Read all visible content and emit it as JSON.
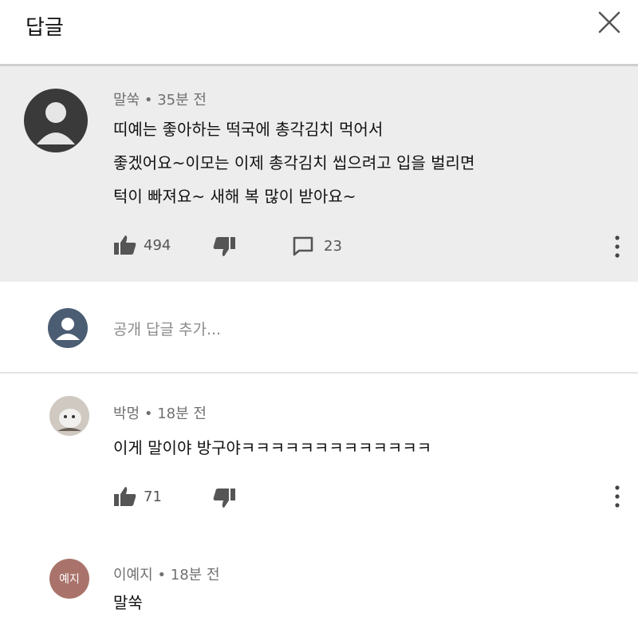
{
  "header": {
    "title": "답글"
  },
  "top_comment": {
    "author": "말쑥",
    "time": "35분 전",
    "lines": [
      "띠예는 좋아하는 떡국에 총각김치 먹어서",
      "좋겠어요~이모는 이제 총각김치 씹으려고 입을 벌리면",
      "턱이 빠져요~ 새해 복 많이 받아요~"
    ],
    "likes": "494",
    "replies": "23"
  },
  "reply_input": {
    "placeholder": "공개 답글 추가..."
  },
  "replies": [
    {
      "author": "박멍",
      "time": "18분 전",
      "text": "이게 말이야 방구야ㅋㅋㅋㅋㅋㅋㅋㅋㅋㅋㅋㅋㅋ",
      "likes": "71"
    },
    {
      "author": "이예지",
      "avatar_text": "예지",
      "time": "18분 전",
      "text": "말쑥"
    }
  ],
  "colors": {
    "top_bg": "#ededed",
    "avatar_reply2": "#a9736b",
    "avatar_user": "#4b5d72"
  }
}
